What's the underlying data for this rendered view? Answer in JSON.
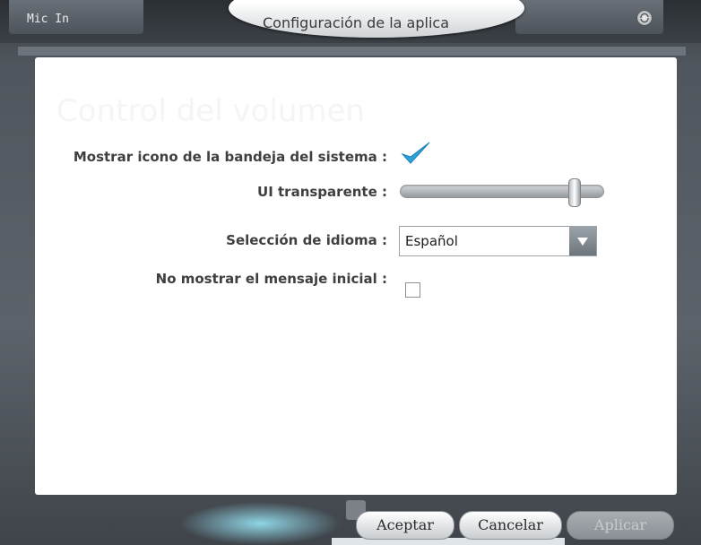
{
  "window": {
    "title": "Configuración de la aplica",
    "mic_label": "Mic In"
  },
  "panel": {
    "background_heading": "Control del volumen"
  },
  "settings": {
    "tray_icon_label": "Mostrar icono de la bandeja del sistema :",
    "tray_icon_checked": true,
    "transparent_ui_label": "UI transparente :",
    "transparency_level": 0.85,
    "language_label": "Selección de idioma :",
    "language_value": "Español",
    "no_startup_message_label": "No mostrar el mensaje inicial :",
    "no_startup_message_checked": false
  },
  "buttons": {
    "accept": "Aceptar",
    "cancel": "Cancelar",
    "apply": "Aplicar"
  },
  "colors": {
    "checkmark": "#2ea3d9",
    "panel_bg": "#ffffff",
    "frame_bg": "#4a4f55"
  }
}
